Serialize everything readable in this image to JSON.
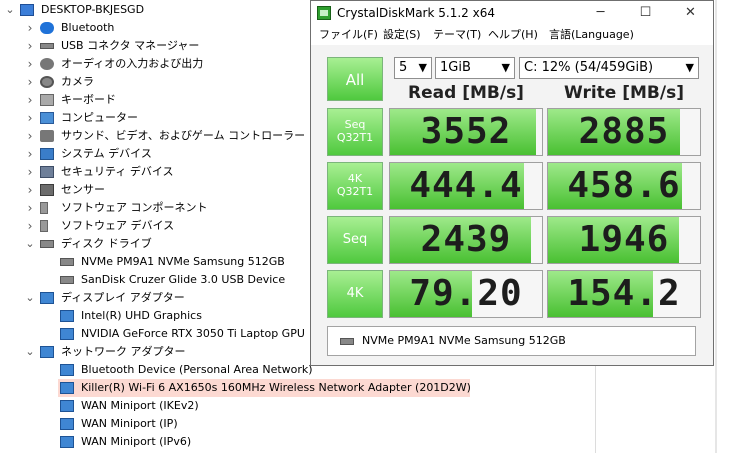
{
  "device_manager": {
    "rows": [
      {
        "label": "DESKTOP-BKJESGD",
        "level": 0,
        "icon": "computer-icon",
        "expander": "open"
      },
      {
        "label": "Bluetooth",
        "level": 1,
        "icon": "bluetooth-icon",
        "expander": "closed"
      },
      {
        "label": "USB コネクタ マネージャー",
        "level": 1,
        "icon": "usb-icon",
        "expander": "closed"
      },
      {
        "label": "オーディオの入力および出力",
        "level": 1,
        "icon": "audio-icon",
        "expander": "closed"
      },
      {
        "label": "カメラ",
        "level": 1,
        "icon": "camera-icon",
        "expander": "closed"
      },
      {
        "label": "キーボード",
        "level": 1,
        "icon": "keyboard-icon",
        "expander": "closed"
      },
      {
        "label": "コンピューター",
        "level": 1,
        "icon": "monitor-icon",
        "expander": "closed"
      },
      {
        "label": "サウンド、ビデオ、およびゲーム コントローラー",
        "level": 1,
        "icon": "sound-icon",
        "expander": "closed"
      },
      {
        "label": "システム デバイス",
        "level": 1,
        "icon": "system-icon",
        "expander": "closed"
      },
      {
        "label": "セキュリティ デバイス",
        "level": 1,
        "icon": "security-icon",
        "expander": "closed"
      },
      {
        "label": "センサー",
        "level": 1,
        "icon": "sensor-icon",
        "expander": "closed"
      },
      {
        "label": "ソフトウェア コンポーネント",
        "level": 1,
        "icon": "software-icon",
        "expander": "closed"
      },
      {
        "label": "ソフトウェア デバイス",
        "level": 1,
        "icon": "software-icon",
        "expander": "closed"
      },
      {
        "label": "ディスク ドライブ",
        "level": 1,
        "icon": "disk-icon",
        "expander": "open"
      },
      {
        "label": "NVMe PM9A1 NVMe Samsung 512GB",
        "level": 2,
        "icon": "disk-icon",
        "expander": "none"
      },
      {
        "label": "SanDisk Cruzer Glide 3.0 USB Device",
        "level": 2,
        "icon": "disk-icon",
        "expander": "none"
      },
      {
        "label": "ディスプレイ アダプター",
        "level": 1,
        "icon": "display-adapter-icon",
        "expander": "open"
      },
      {
        "label": "Intel(R) UHD Graphics",
        "level": 2,
        "icon": "display-adapter-icon",
        "expander": "none"
      },
      {
        "label": "NVIDIA GeForce RTX 3050 Ti Laptop GPU",
        "level": 2,
        "icon": "display-adapter-icon",
        "expander": "none"
      },
      {
        "label": "ネットワーク アダプター",
        "level": 1,
        "icon": "network-icon",
        "expander": "open"
      },
      {
        "label": "Bluetooth Device (Personal Area Network)",
        "level": 2,
        "icon": "network-icon",
        "expander": "none"
      },
      {
        "label": "Killer(R) Wi-Fi 6 AX1650s 160MHz Wireless Network Adapter (201D2W)",
        "level": 2,
        "icon": "network-icon",
        "expander": "none",
        "selected": true
      },
      {
        "label": "WAN Miniport (IKEv2)",
        "level": 2,
        "icon": "network-icon",
        "expander": "none"
      },
      {
        "label": "WAN Miniport (IP)",
        "level": 2,
        "icon": "network-icon",
        "expander": "none"
      },
      {
        "label": "WAN Miniport (IPv6)",
        "level": 2,
        "icon": "network-icon",
        "expander": "none"
      }
    ]
  },
  "cdm": {
    "title": "CrystalDiskMark 5.1.2 x64",
    "window_buttons": {
      "minimize": "─",
      "maximize": "☐",
      "close": "✕"
    },
    "menu": [
      "ファイル(F)",
      "設定(S)",
      "テーマ(T)",
      "ヘルプ(H)",
      "言語(Language)"
    ],
    "all_label": "All",
    "count": "5",
    "size": "1GiB",
    "drive": "C: 12% (54/459GiB)",
    "read_header": "Read [MB/s]",
    "write_header": "Write [MB/s]",
    "tests": [
      {
        "top": "Seq",
        "bottom": "Q32T1",
        "read": "3552",
        "write": "2885",
        "read_fill": 0.96,
        "write_fill": 0.87
      },
      {
        "top": "4K",
        "bottom": "Q32T1",
        "read": "444.4",
        "write": "458.6",
        "read_fill": 0.88,
        "write_fill": 0.88
      },
      {
        "top": "Seq",
        "bottom": "",
        "read": "2439",
        "write": "1946",
        "read_fill": 0.93,
        "write_fill": 0.86
      },
      {
        "top": "4K",
        "bottom": "",
        "read": "79.20",
        "write": "154.2",
        "read_fill": 0.54,
        "write_fill": 0.69
      }
    ],
    "drive_model": "NVMe PM9A1 NVMe Samsung 512GB"
  },
  "colors": {
    "accent_green": "#4fc93e",
    "selected_row": "#fcd9d2"
  }
}
